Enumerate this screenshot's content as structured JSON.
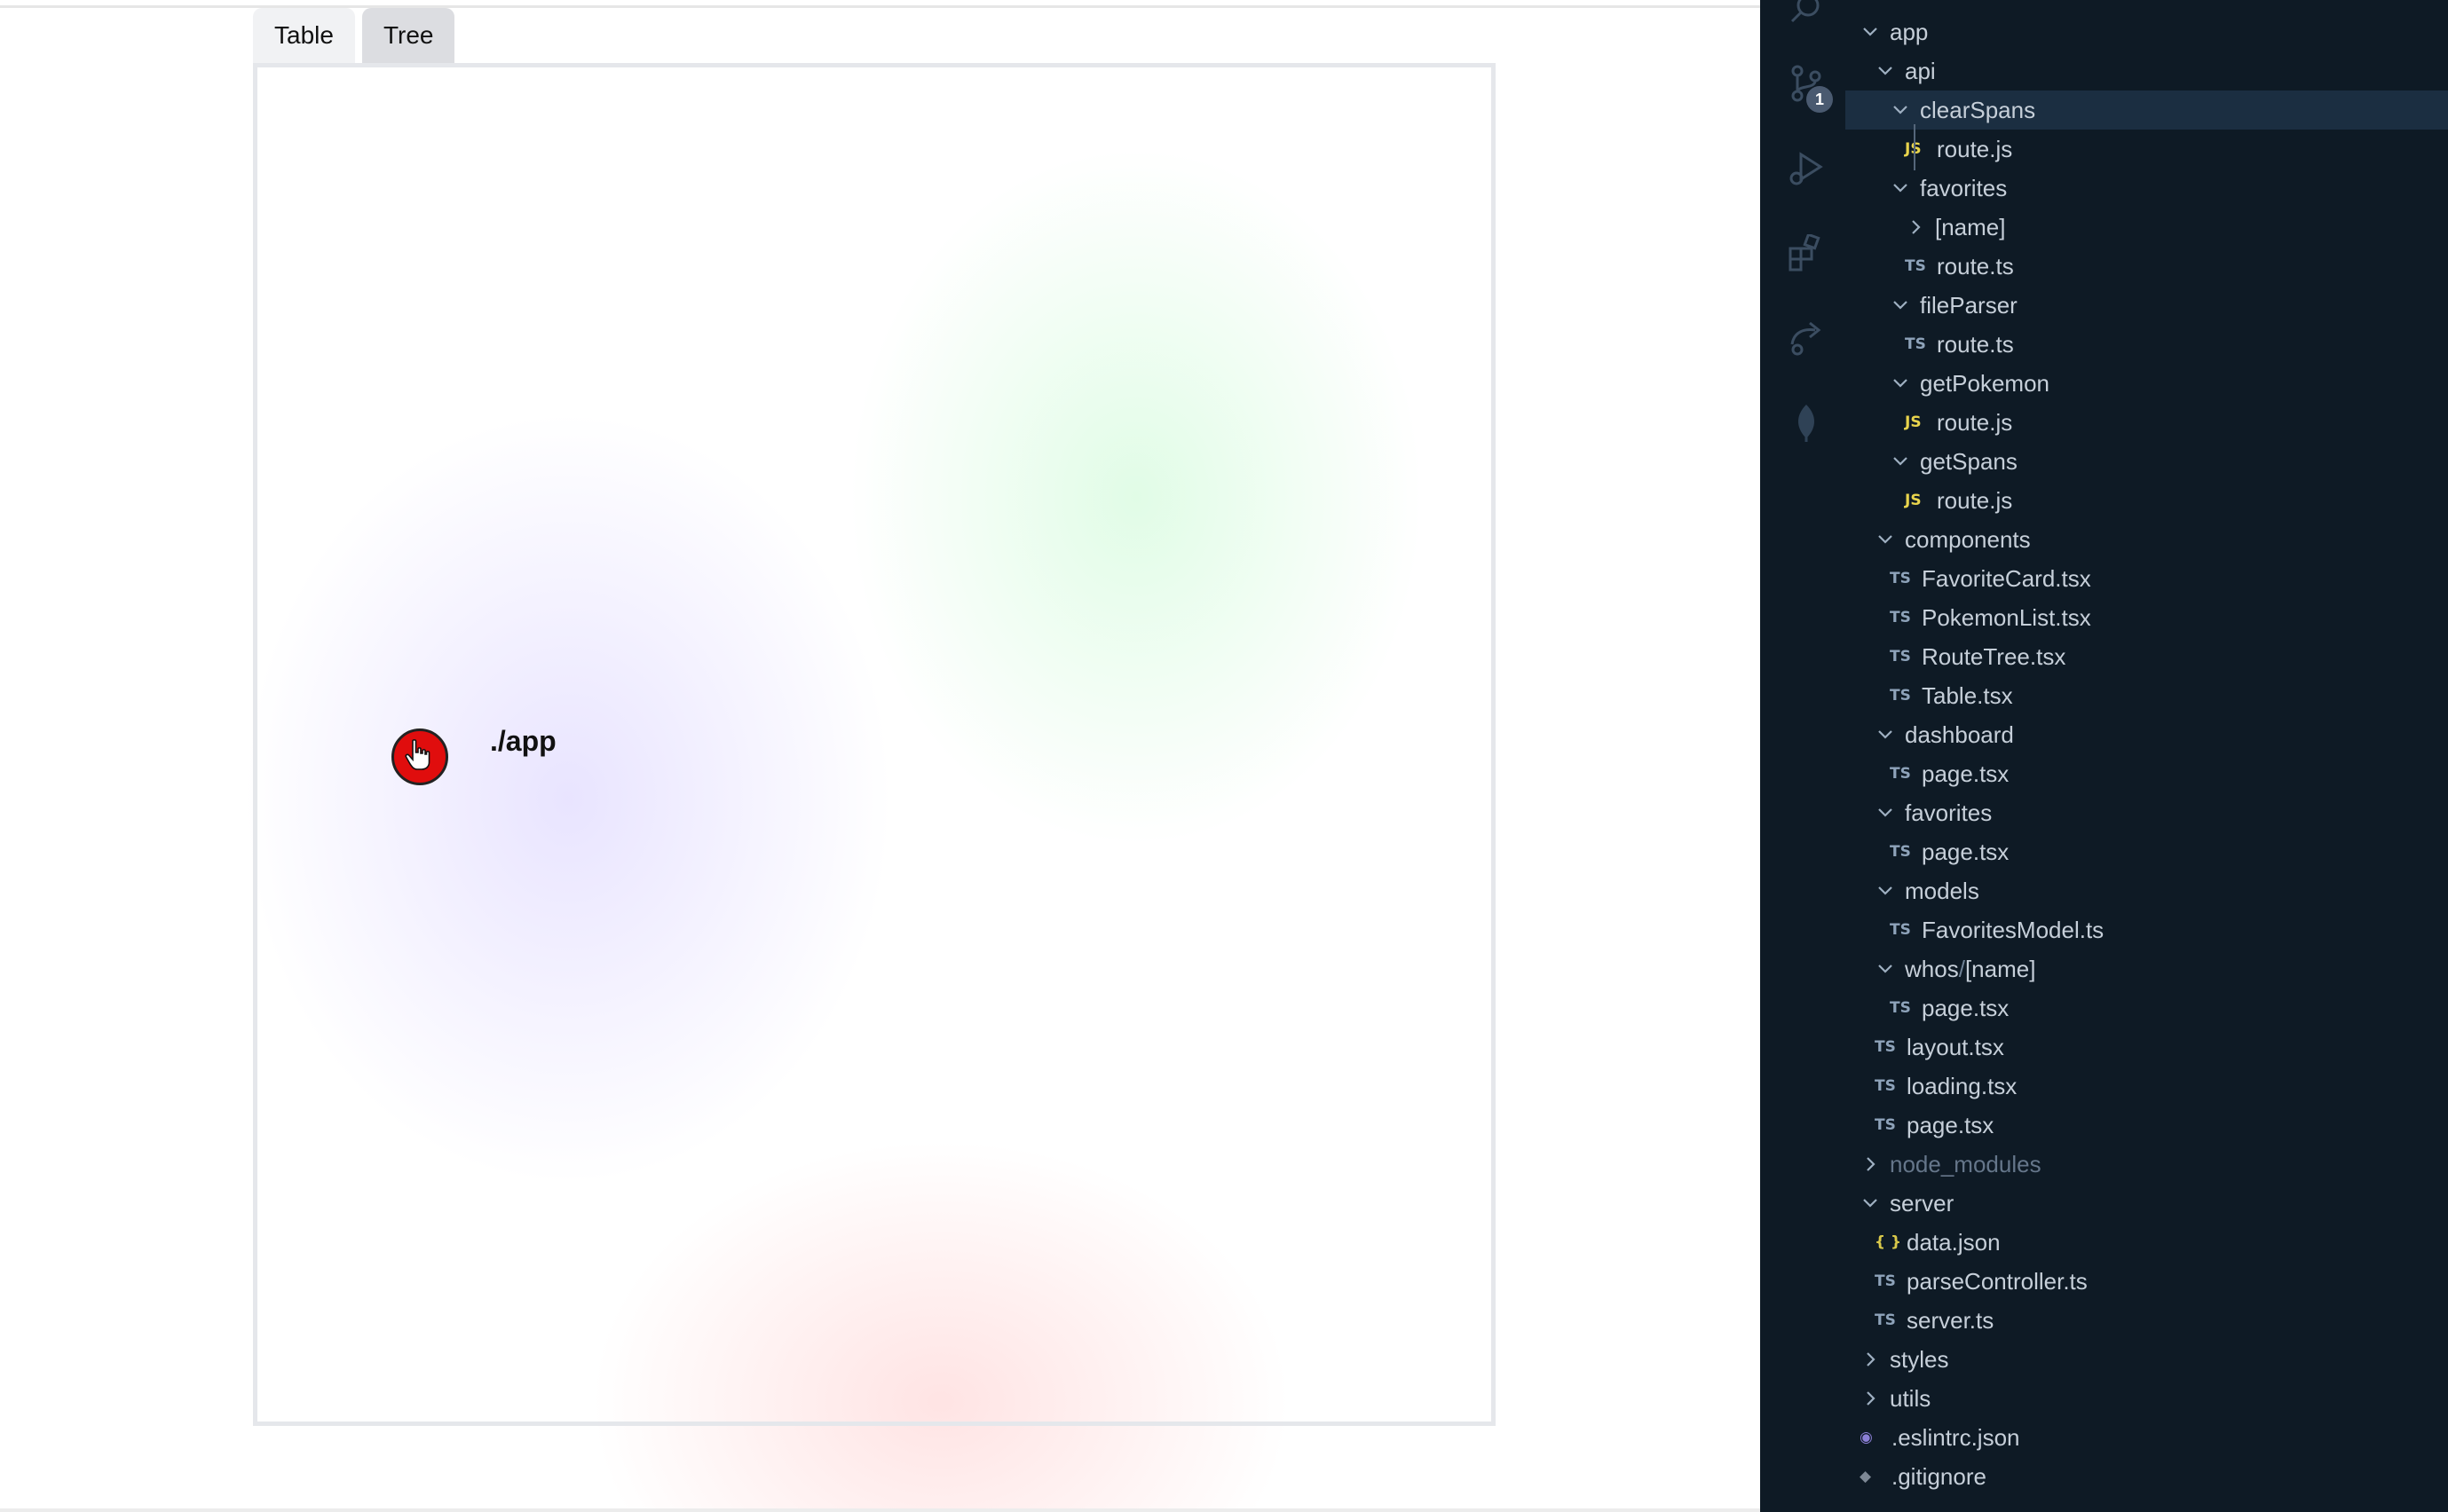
{
  "browser": {
    "tabs": [
      {
        "label": "Table",
        "active": false
      },
      {
        "label": "Tree",
        "active": true
      }
    ],
    "tree_node": {
      "label": "./app",
      "color": "#e00d0d"
    }
  },
  "sidebar": {
    "source_control_badge": "1",
    "items": [
      {
        "label": "app",
        "type": "folder",
        "expanded": true,
        "depth": 0
      },
      {
        "label": "api",
        "type": "folder",
        "expanded": true,
        "depth": 1
      },
      {
        "label": "clearSpans",
        "type": "folder",
        "expanded": true,
        "depth": 2,
        "selected": true
      },
      {
        "label": "route.js",
        "type": "js",
        "depth": 3
      },
      {
        "label": "favorites",
        "type": "folder",
        "expanded": true,
        "depth": 2
      },
      {
        "label": "[name]",
        "type": "folder",
        "expanded": false,
        "depth": 3
      },
      {
        "label": "route.ts",
        "type": "ts",
        "depth": 3
      },
      {
        "label": "fileParser",
        "type": "folder",
        "expanded": true,
        "depth": 2
      },
      {
        "label": "route.ts",
        "type": "ts",
        "depth": 3
      },
      {
        "label": "getPokemon",
        "type": "folder",
        "expanded": true,
        "depth": 2
      },
      {
        "label": "route.js",
        "type": "js",
        "depth": 3
      },
      {
        "label": "getSpans",
        "type": "folder",
        "expanded": true,
        "depth": 2
      },
      {
        "label": "route.js",
        "type": "js",
        "depth": 3
      },
      {
        "label": "components",
        "type": "folder",
        "expanded": true,
        "depth": 1
      },
      {
        "label": "FavoriteCard.tsx",
        "type": "ts",
        "depth": 2
      },
      {
        "label": "PokemonList.tsx",
        "type": "ts",
        "depth": 2
      },
      {
        "label": "RouteTree.tsx",
        "type": "ts",
        "depth": 2
      },
      {
        "label": "Table.tsx",
        "type": "ts",
        "depth": 2
      },
      {
        "label": "dashboard",
        "type": "folder",
        "expanded": true,
        "depth": 1
      },
      {
        "label": "page.tsx",
        "type": "ts",
        "depth": 2
      },
      {
        "label": "favorites",
        "type": "folder",
        "expanded": true,
        "depth": 1
      },
      {
        "label": "page.tsx",
        "type": "ts",
        "depth": 2
      },
      {
        "label": "models",
        "type": "folder",
        "expanded": true,
        "depth": 1
      },
      {
        "label": "FavoritesModel.ts",
        "type": "ts",
        "depth": 2
      },
      {
        "label": "whos",
        "label_suffix": "[name]",
        "type": "folder",
        "expanded": true,
        "depth": 1
      },
      {
        "label": "page.tsx",
        "type": "ts",
        "depth": 2
      },
      {
        "label": "layout.tsx",
        "type": "ts",
        "depth": 1
      },
      {
        "label": "loading.tsx",
        "type": "ts",
        "depth": 1
      },
      {
        "label": "page.tsx",
        "type": "ts",
        "depth": 1
      },
      {
        "label": "node_modules",
        "type": "folder",
        "expanded": false,
        "depth": 0,
        "dim": true
      },
      {
        "label": "server",
        "type": "folder",
        "expanded": true,
        "depth": 0
      },
      {
        "label": "data.json",
        "type": "json",
        "depth": 1
      },
      {
        "label": "parseController.ts",
        "type": "ts",
        "depth": 1
      },
      {
        "label": "server.ts",
        "type": "ts",
        "depth": 1
      },
      {
        "label": "styles",
        "type": "folder",
        "expanded": false,
        "depth": 0
      },
      {
        "label": "utils",
        "type": "folder",
        "expanded": false,
        "depth": 0
      },
      {
        "label": ".eslintrc.json",
        "type": "eslint",
        "depth": 0
      },
      {
        "label": ".gitignore",
        "type": "git",
        "depth": 0
      }
    ],
    "file_icons": {
      "ts": "TS",
      "js": "JS",
      "json": "{ }",
      "eslint": "◉",
      "git": "◆"
    },
    "colors": {
      "background": "#0e1a25",
      "selected_row": "#1b2e41",
      "text": "#c6cfd9"
    }
  }
}
